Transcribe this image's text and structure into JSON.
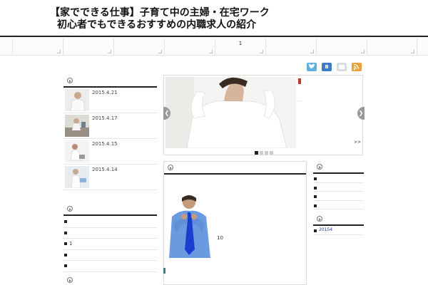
{
  "header": {
    "title_line1": "【家でできる仕事】子育て中の主婦・在宅ワーク",
    "title_line2": "初心者でもできるおすすめの内職求人の紹介"
  },
  "nav": {
    "items": [
      "",
      "",
      "",
      "",
      "1",
      "",
      "",
      ""
    ]
  },
  "share": {
    "hatena_label": "B"
  },
  "sidebar_left": {
    "recent_posts": [
      {
        "date": "2015.4.21"
      },
      {
        "date": "2015.4.17"
      },
      {
        "date": "2015.4.15"
      },
      {
        "date": "2015.4.14"
      }
    ],
    "category_items": [
      "",
      "",
      "1",
      "",
      ""
    ]
  },
  "slider": {
    "next_label": ">>",
    "side_mark": "...",
    "left_arrow": "❮",
    "right_arrow": "❯"
  },
  "main": {
    "image_caption": "10"
  },
  "sidebar_right": {
    "list1": [
      "",
      "",
      "",
      ""
    ],
    "list2": [
      "20154"
    ]
  },
  "colors": {
    "accent_dark": "#222222",
    "twitter": "#5fb0e0",
    "hatena": "#3a7cc8",
    "rss": "#e8a33c"
  }
}
